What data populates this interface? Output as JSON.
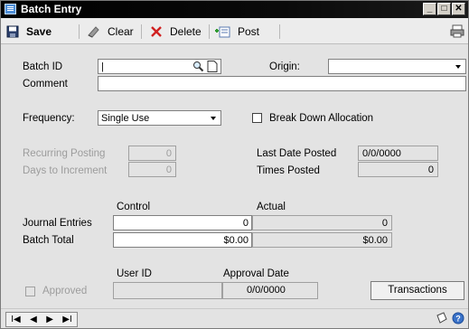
{
  "window": {
    "title": "Batch Entry",
    "controls": [
      "minimize",
      "maximize",
      "close"
    ]
  },
  "toolbar": {
    "save": "Save",
    "clear": "Clear",
    "delete": "Delete",
    "post": "Post"
  },
  "form": {
    "batch_id_label": "Batch ID",
    "batch_id_value": "|",
    "origin_label": "Origin:",
    "origin_value": "",
    "comment_label": "Comment",
    "comment_value": "",
    "frequency_label": "Frequency:",
    "frequency_value": "Single Use",
    "break_down_label": "Break Down Allocation",
    "recurring_posting_label": "Recurring Posting",
    "recurring_posting_value": "0",
    "days_to_increment_label": "Days to Increment",
    "days_to_increment_value": "0",
    "last_date_posted_label": "Last Date Posted",
    "last_date_posted_value": "0/0/0000",
    "times_posted_label": "Times Posted",
    "times_posted_value": "0"
  },
  "totals": {
    "control_header": "Control",
    "actual_header": "Actual",
    "journal_entries_label": "Journal Entries",
    "journal_entries_control": "0",
    "journal_entries_actual": "0",
    "batch_total_label": "Batch Total",
    "batch_total_control": "$0.00",
    "batch_total_actual": "$0.00"
  },
  "approval": {
    "user_id_header": "User ID",
    "approval_date_header": "Approval Date",
    "approved_label": "Approved",
    "user_id_value": "",
    "approval_date_value": "0/0/0000",
    "transactions_button": "Transactions"
  },
  "status": {
    "nav_first": "I◀",
    "nav_prev": "◀",
    "nav_next": "▶",
    "nav_last": "▶I"
  }
}
